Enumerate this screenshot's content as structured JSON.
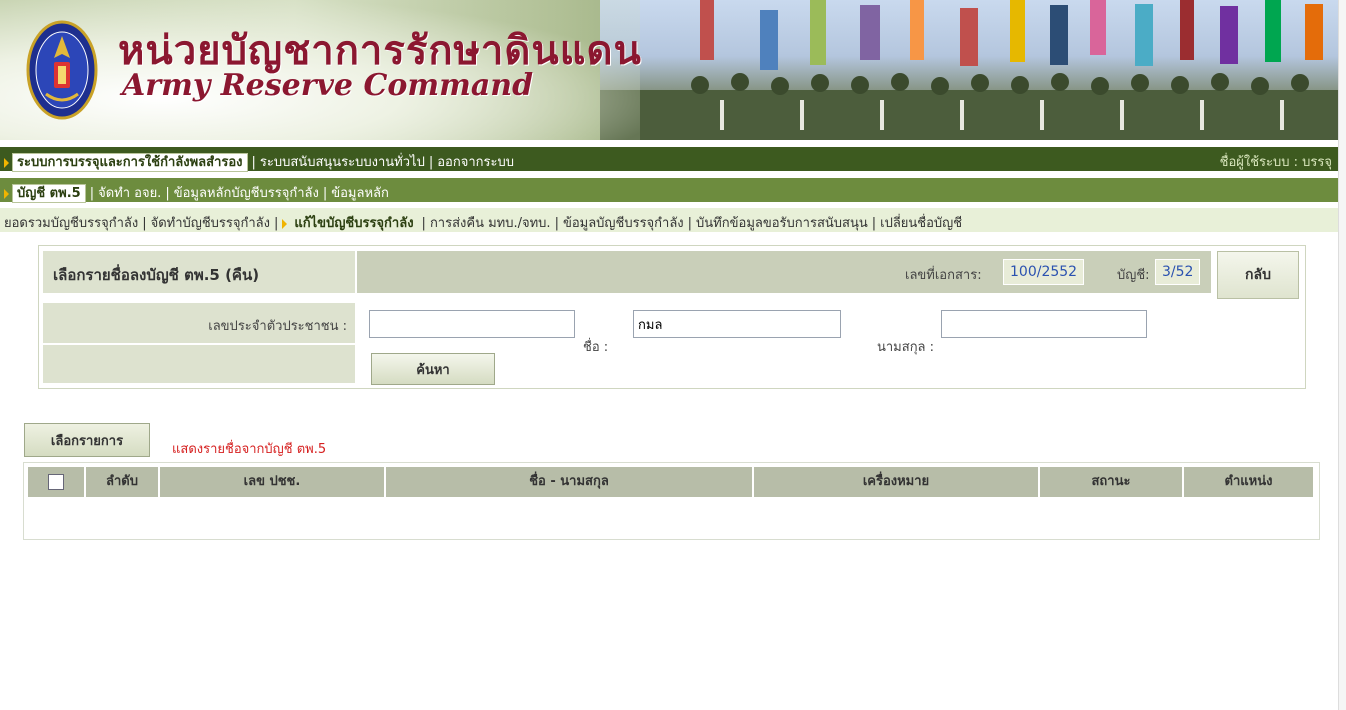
{
  "header": {
    "title_th": "หน่วยบัญชาการรักษาดินแดน",
    "title_en": "Army Reserve Command"
  },
  "menu1": {
    "items": [
      "ระบบการบรรจุและการใช้กำลังพลสำรอง",
      "ระบบสนับสนุนระบบงานทั่วไป",
      "ออกจากระบบ"
    ],
    "user_label": "ชื่อผู้ใช้ระบบ : บรรจุ"
  },
  "menu2": {
    "items": [
      "บัญชี ตพ.5",
      "จัดทำ อจย.",
      "ข้อมูลหลักบัญชีบรรจุกำลัง",
      "ข้อมูลหลัก"
    ]
  },
  "menu3": {
    "items": [
      "ยอดรวมบัญชีบรรจุกำลัง",
      "จัดทำบัญชีบรรจุกำลัง",
      "แก้ไขบัญชีบรรจุกำลัง",
      "การส่งคืน มทบ./จทบ.",
      "ข้อมูลบัญชีบรรจุกำลัง",
      "บันทึกข้อมูลขอรับการสนับสนุน",
      "เปลี่ยนชื่อบัญชี"
    ]
  },
  "panel": {
    "title": "เลือกรายชื่อลงบัญชี ตพ.5 (คืน)",
    "doc_no_label": "เลขที่เอกสาร:",
    "doc_no": "100/2552",
    "account_label": "บัญชี:",
    "account": "3/52",
    "back_label": "กลับ",
    "id_label": "เลขประจำตัวประชาชน :",
    "id_value": "",
    "name_label": "ชื่อ :",
    "name_value": "กมล",
    "surname_label": "นามสกุล :",
    "surname_value": "",
    "search_label": "ค้นหา"
  },
  "results": {
    "select_label": "เลือกรายการ",
    "caption": "แสดงรายชื่อจากบัญชี ตพ.5",
    "columns": [
      "ลำดับ",
      "เลข ปชช.",
      "ชื่อ - นามสกุล",
      "เครื่องหมาย",
      "สถานะ",
      "ตำแหน่ง"
    ]
  },
  "colors": {
    "menu_dark": "#3d5a1f",
    "menu_mid": "#6d8c3e",
    "menu_light": "#e8f0d8",
    "title": "#8b1730",
    "caption": "#d62020"
  }
}
